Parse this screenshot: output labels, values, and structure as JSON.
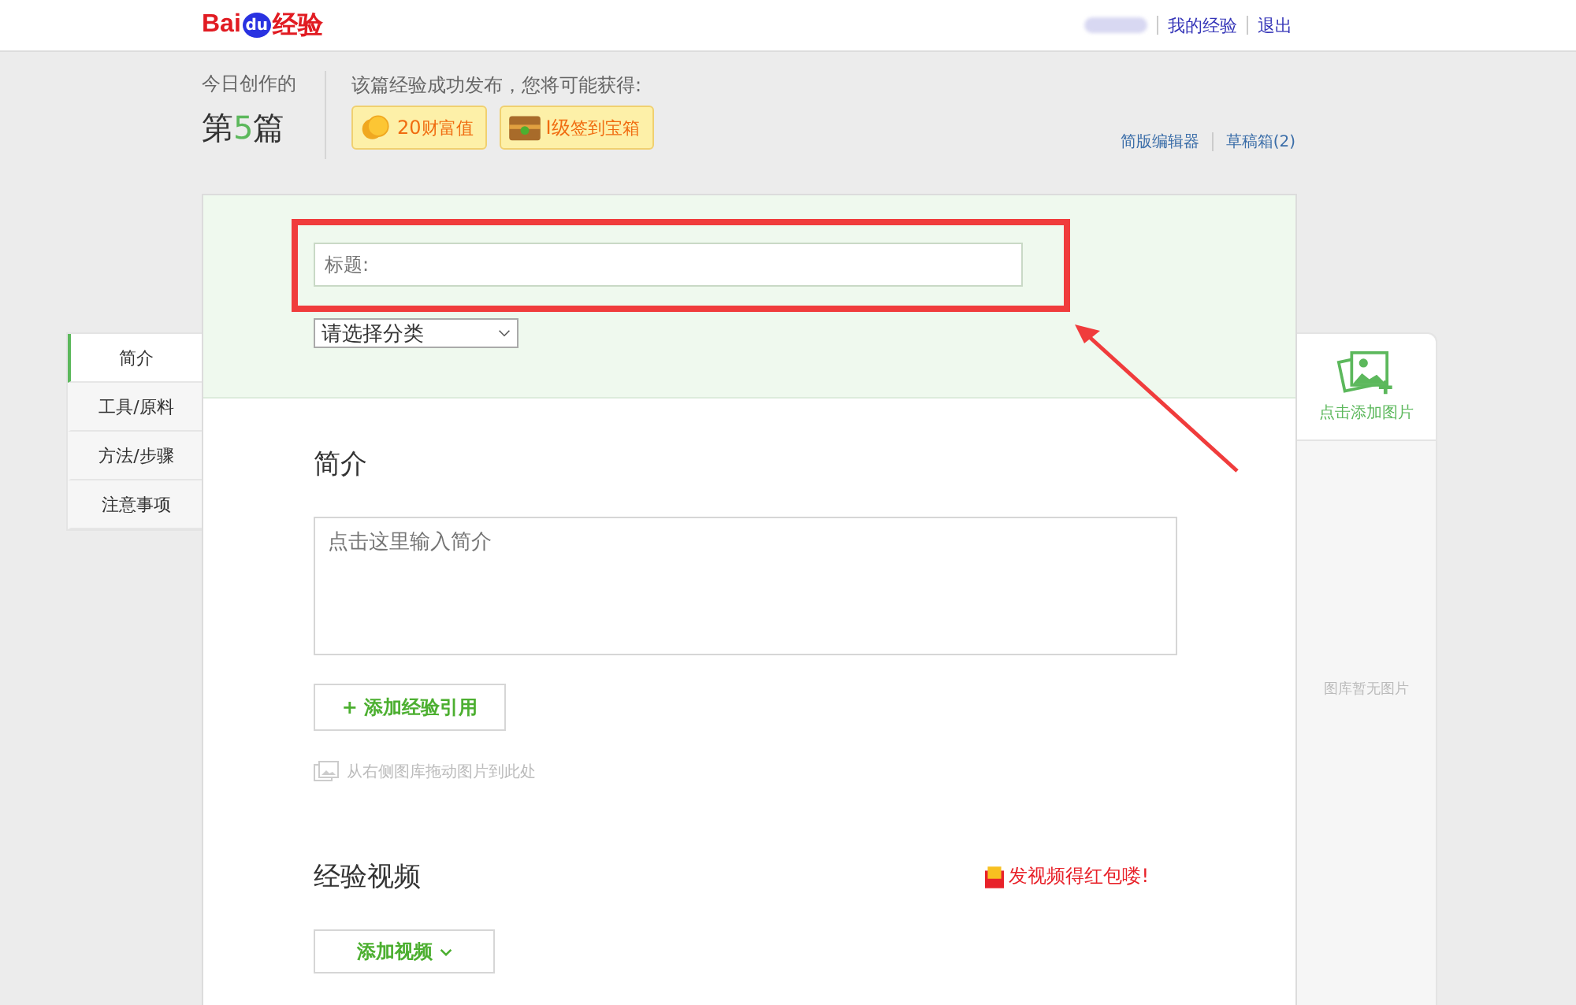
{
  "header": {
    "logo": {
      "left": "Bai",
      "paw": "du",
      "right": "经验"
    },
    "user_links": [
      "我的经验",
      "退出"
    ]
  },
  "today": {
    "label": "今日创作的",
    "prefix": "第",
    "count": "5",
    "suffix": "篇"
  },
  "rewards": {
    "title": "该篇经验成功发布，您将可能获得:",
    "items": [
      {
        "kind": "coin",
        "value": "20",
        "label": "财富值"
      },
      {
        "kind": "chest",
        "value": "I级",
        "label": "签到宝箱"
      }
    ]
  },
  "editor_links": [
    "简版编辑器",
    "草稿箱(2)"
  ],
  "title_field": {
    "placeholder": "标题:"
  },
  "category_select": {
    "value": "请选择分类"
  },
  "side_nav": [
    {
      "label": "简介",
      "selected": true
    },
    {
      "label": "工具/原料",
      "selected": false
    },
    {
      "label": "方法/步骤",
      "selected": false
    },
    {
      "label": "注意事项",
      "selected": false
    }
  ],
  "intro": {
    "heading": "简介",
    "placeholder": "点击这里输入简介",
    "add_button": "+ 添加经验引用",
    "drag_hint": "从右侧图库拖动图片到此处"
  },
  "video": {
    "heading": "经验视频",
    "promo": "发视频得红包喽!",
    "add_button": "添加视频"
  },
  "gallery": {
    "add_label": "点击添加图片",
    "empty_text": "图库暂无图片"
  }
}
